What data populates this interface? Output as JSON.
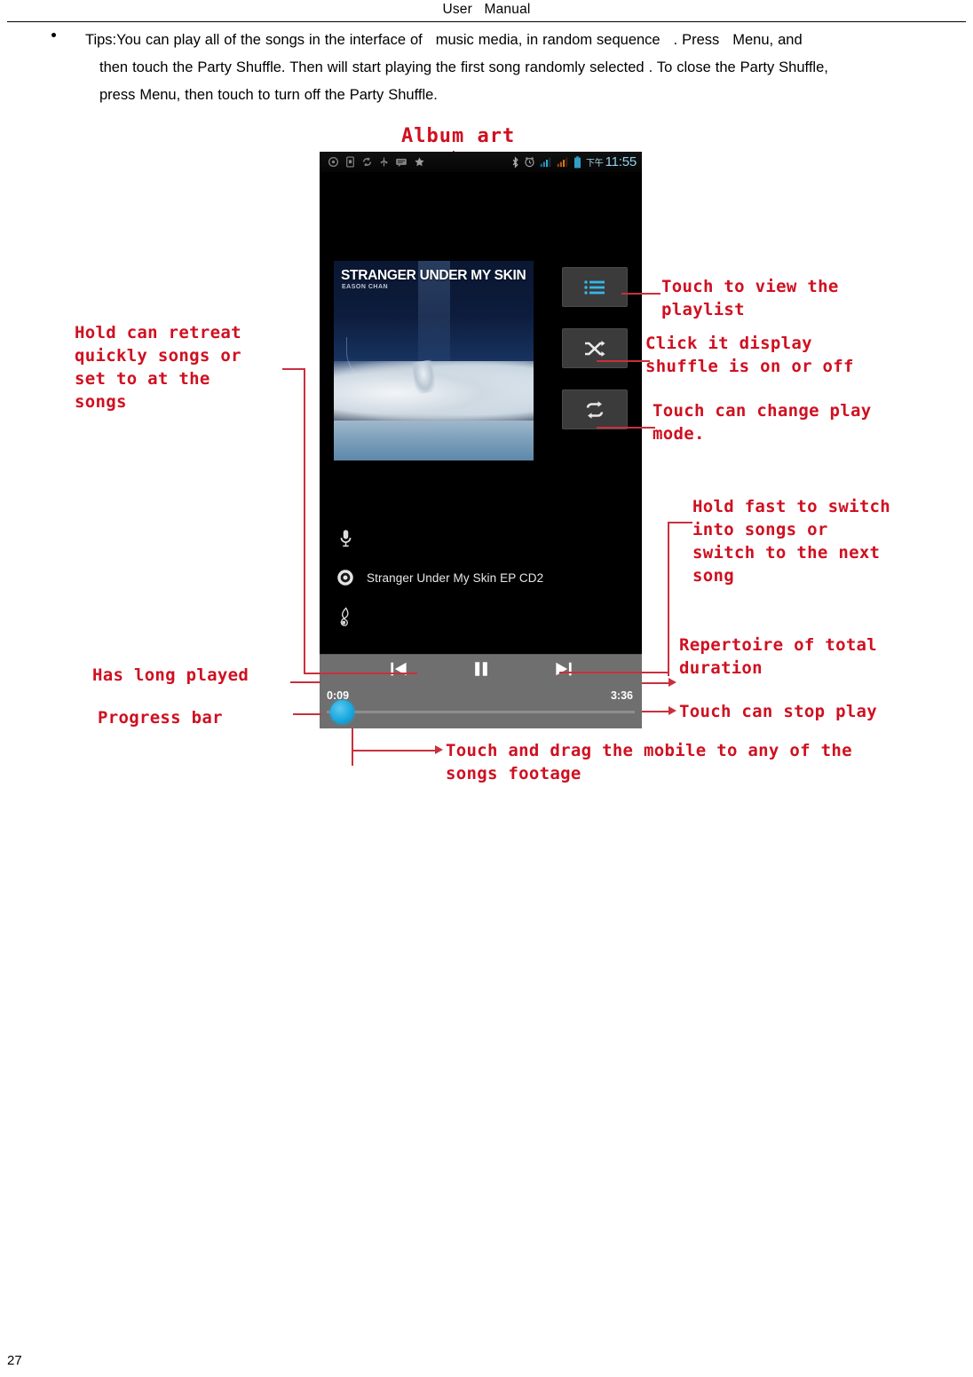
{
  "header": {
    "title": "User   Manual"
  },
  "tips": {
    "line1": "Tips:You can play all of the songs in the interface of   music media, in random sequence   . Press   Menu, and",
    "line2": "then touch the Party Shuffle. Then will start playing the first song randomly selected . To close the Party Shuffle,",
    "line3": "press Menu, then touch to turn off the Party Shuffle."
  },
  "annotations": {
    "album_art": "Album art",
    "hold_retreat": "Hold can retreat\nquickly songs or\nset to at the\nsongs",
    "has_long_played": "Has long played",
    "progress_bar": "Progress bar",
    "view_playlist": "Touch to view the\nplaylist",
    "shuffle_toggle": "Click it display\nshuffle is on or off",
    "play_mode": "Touch can change play\nmode.",
    "hold_fast_switch": "Hold fast to switch\ninto songs or\nswitch to the next\nsong",
    "total_duration": "Repertoire of total\nduration",
    "stop_play": "Touch can stop play",
    "drag_footage": "Touch and drag the mobile to any of the\nsongs footage"
  },
  "phone": {
    "statusbar": {
      "left_icons": [
        "location-icon",
        "sim-card-icon",
        "sync-icon",
        "usb-icon",
        "message-icon",
        "star-icon"
      ],
      "right_icons": [
        "bluetooth-icon",
        "alarm-clock-icon",
        "signal-bars-sim1-icon",
        "signal-bars-sim2-icon",
        "battery-icon"
      ],
      "ampm": "下午",
      "time": "11:55"
    },
    "album": {
      "art_title": "STRANGER UNDER MY SKIN",
      "art_artist": "EASON CHAN"
    },
    "side_buttons": [
      {
        "name": "playlist-button",
        "icon": "playlist-icon"
      },
      {
        "name": "shuffle-button",
        "icon": "shuffle-icon"
      },
      {
        "name": "repeat-button",
        "icon": "repeat-icon"
      }
    ],
    "meta": [
      {
        "icon": "microphone-icon",
        "label": ""
      },
      {
        "icon": "disc-icon",
        "label": "Stranger Under My Skin EP CD2"
      },
      {
        "icon": "music-note-icon",
        "label": ""
      }
    ],
    "controls": {
      "previous": "previous-icon",
      "pause": "pause-icon",
      "next": "next-icon",
      "elapsed": "0:09",
      "duration": "3:36"
    }
  },
  "footer": {
    "page_number": "27"
  },
  "colors": {
    "annotation_red": "#cf1020",
    "leader_red": "#c9303c",
    "accent_blue": "#19a9e0",
    "controls_gray": "#6f6f6f"
  }
}
